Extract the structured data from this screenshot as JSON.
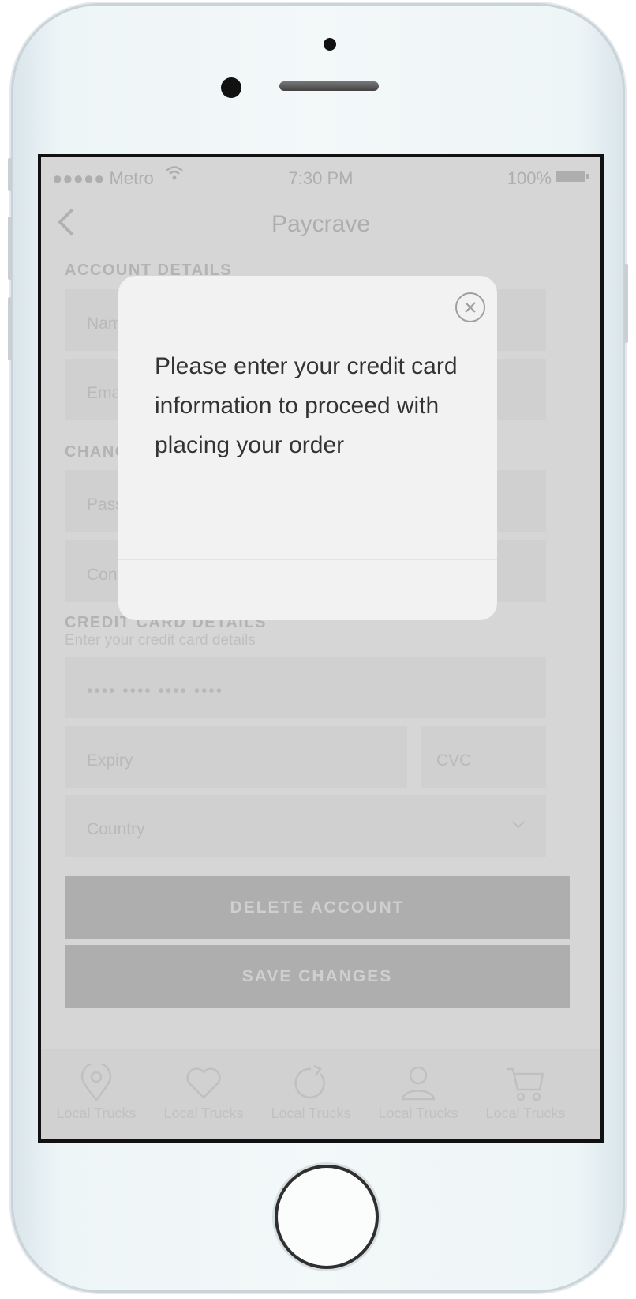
{
  "status_bar": {
    "carrier": "●●●●● Metro",
    "time": "7:30 PM",
    "battery": "100%"
  },
  "nav": {
    "title": "Paycrave",
    "back_icon": "chevron-left-icon"
  },
  "account_details": {
    "heading": "ACCOUNT DETAILS",
    "name_placeholder": "Name",
    "email_placeholder": "Email"
  },
  "change_password": {
    "heading": "CHANGE PASSWORD",
    "password_placeholder": "Password",
    "confirm_placeholder": "Confirm Password"
  },
  "credit_card": {
    "heading": "CREDIT CARD DETAILS",
    "subtitle": "Enter your credit card details",
    "number_placeholder": "•••• •••• •••• ••••",
    "expiry_placeholder": "Expiry",
    "cvc_placeholder": "CVC",
    "country_placeholder": "Country"
  },
  "buttons": {
    "delete_account": "DELETE ACCOUNT",
    "save_changes": "SAVE CHANGES"
  },
  "tabs": [
    {
      "label": "Local Trucks",
      "icon": "location-pin-icon"
    },
    {
      "label": "Local Trucks",
      "icon": "heart-icon"
    },
    {
      "label": "Local Trucks",
      "icon": "refresh-icon"
    },
    {
      "label": "Local Trucks",
      "icon": "user-icon"
    },
    {
      "label": "Local Trucks",
      "icon": "cart-icon"
    }
  ],
  "modal": {
    "message": "Please enter your credit card information to proceed with placing your order",
    "close_icon": "close-circle-icon"
  }
}
